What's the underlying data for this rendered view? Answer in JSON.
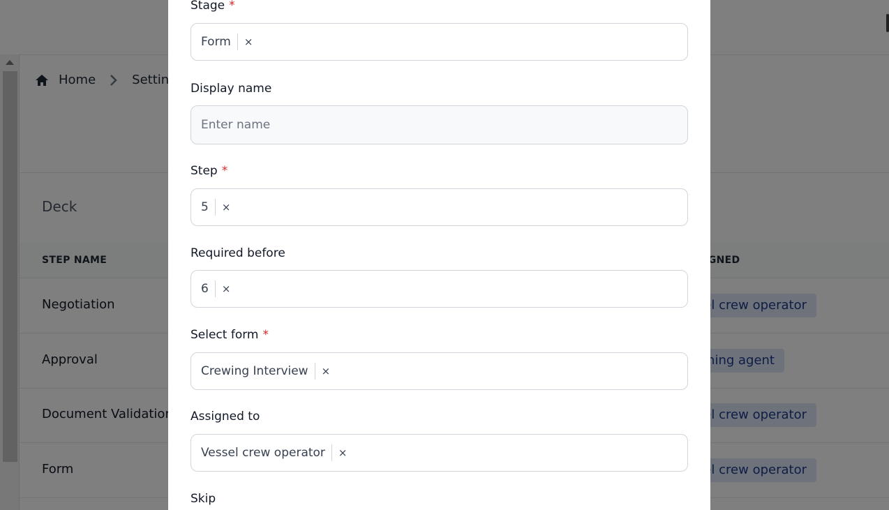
{
  "breadcrumb": {
    "home": "Home",
    "settings": "Settings"
  },
  "section_title": "Deck",
  "table": {
    "headers": {
      "step_name": "STEP NAME",
      "assigned": "ASSIGNED"
    },
    "rows": [
      {
        "name": "Negotiation",
        "assigned": "Vessel crew operator"
      },
      {
        "name": "Approval",
        "assigned": "Manning agent"
      },
      {
        "name": "Document Validation",
        "assigned": "Vessel crew operator"
      },
      {
        "name": "Form",
        "assigned": "Vessel crew operator"
      }
    ],
    "badge_color": "#dbe5f7"
  },
  "modal": {
    "stage": {
      "label": "Stage",
      "required": "*",
      "value": "Form"
    },
    "display_name": {
      "label": "Display name",
      "placeholder": "Enter name"
    },
    "step": {
      "label": "Step",
      "required": "*",
      "value": "5"
    },
    "required_before": {
      "label": "Required before",
      "value": "6"
    },
    "select_form": {
      "label": "Select form",
      "required": "*",
      "value": "Crewing Interview"
    },
    "assigned_to": {
      "label": "Assigned to",
      "value": "Vessel crew operator"
    },
    "skip": {
      "label": "Skip"
    },
    "clear_glyph": "×"
  }
}
